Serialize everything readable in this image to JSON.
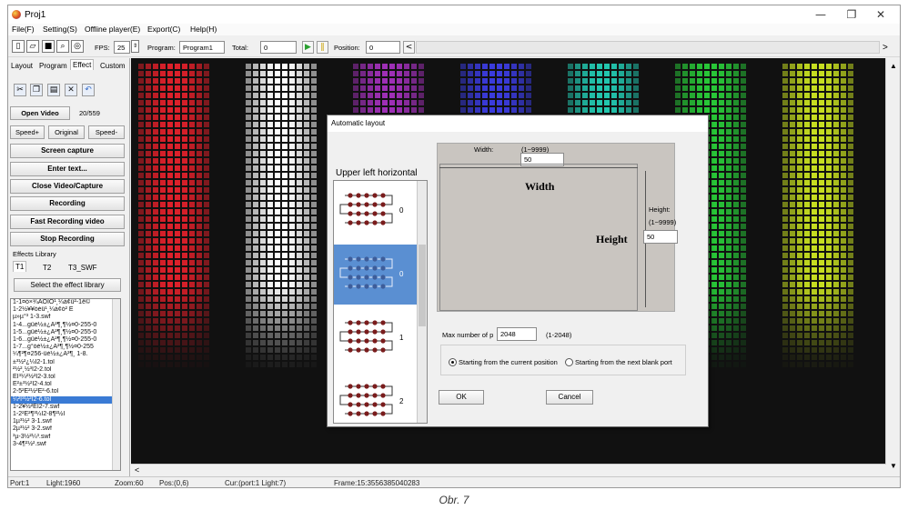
{
  "window": {
    "title": "Proj1",
    "minimize": "—",
    "restore": "❐",
    "close": "✕"
  },
  "menu": [
    "File(F)",
    "Setting(S)",
    "Offline player(E)",
    "Export(C)",
    "Help(H)"
  ],
  "toolbar": {
    "fps_label": "FPS:",
    "fps_value": "25",
    "program_label": "Program:",
    "program_value": "Program1",
    "total_label": "Total:",
    "total_value": "0",
    "position_label": "Position:",
    "position_value": "0",
    "play_icon": "play-icon",
    "pause_icon": "pause-icon",
    "left_arrow": "<",
    "right_arrow": ">"
  },
  "left_tabs": [
    "Layout",
    "Program",
    "Effect",
    "Custom"
  ],
  "active_tab": "Effect",
  "edit_icons": [
    "cut-icon",
    "copy-icon",
    "paste-icon",
    "delete-icon",
    "undo-icon"
  ],
  "video": {
    "open_label": "Open Video",
    "frame_count": "20/559"
  },
  "speed": {
    "plus": "Speed+",
    "original": "Original",
    "minus": "Speed-"
  },
  "buttons": {
    "screen_capture": "Screen capture",
    "enter_text": "Enter text...",
    "close_video": "Close Video/Capture",
    "recording": "Recording",
    "fast_recording": "Fast Recording video",
    "stop_recording": "Stop Recording"
  },
  "effects_library": {
    "label": "Effects Library",
    "tabs": [
      "T1",
      "T2",
      "T3_SWF"
    ],
    "select_label": "Select the effect library",
    "items": [
      "1-1¤ó×¾ÄÖÎÓ¹¸¼á¢û²-1ê©",
      "1-2½¥¥óèü¹¸¼á¢ó² É",
      "µ»µ°³ 1-3.swf",
      "1-4...güè½±¿À²¶¸¶½¤0-255-0",
      "1-5...güè½±¿À²¶¸¶½¤0-255-0",
      "1-6...güè½±¿À²¶¸¶½¤0-255-0",
      "1-7...g°óè½±¿À²¶¸¶½¤0-255",
      "¼¶²¶¤256-üè½±¿À²¶¸ 1-8.",
      "±³½²¿¼Ï2-1.tol",
      "²½²¸½³Ï2-2.tol",
      "ÈÏ³¼²½²Ï2-3.tol",
      "È²±³½²Ï2-4.tol",
      "2-5²È²½²È²-6.tol",
      "¼²Ï³½²Ï2-6.tol",
      "1-2¥½²ÈÏ2-7.swf",
      "1-2²È²¶³¼Ï2-8¶²½Ï",
      "1µ³½² 3-1.swf",
      "2µ³½² 3-2.swf",
      "³µ-3½²¼³.swf",
      "3-4¶²½².swf"
    ],
    "selected_index": 13
  },
  "status": {
    "port": "Port:1",
    "light": "Light:1960",
    "zoom": "Zoom:60",
    "pos": "Pos:(0,6)",
    "cur": "Cur:(port:1 Light:7)",
    "frame": "Frame:15:3556385040283"
  },
  "dialog": {
    "title": "Automatic layout",
    "direction_label": "Upper left horizontal",
    "patterns": [
      "0",
      "0",
      "1",
      "2"
    ],
    "selected_pattern": 1,
    "width_label": "Width:",
    "width_range": "(1~9999)",
    "width_value": "50",
    "width_caption": "Width",
    "height_label": "Height:",
    "height_range": "(1~9999)",
    "height_value": "50",
    "height_caption": "Height",
    "max_label": "Max number of p",
    "max_value": "2048",
    "max_range": "(1-2048)",
    "radio_current": "Starting from the current position",
    "radio_next": "Starting from the next blank port",
    "radio_selected": "current",
    "ok_label": "OK",
    "cancel_label": "Cancel"
  },
  "caption": "Obr. 7",
  "colors": {
    "groups": [
      "#e0202a",
      "#ffffff",
      "#a030b8",
      "#3b3ce0",
      "#22c8b0",
      "#28c838",
      "#c8e020"
    ]
  }
}
